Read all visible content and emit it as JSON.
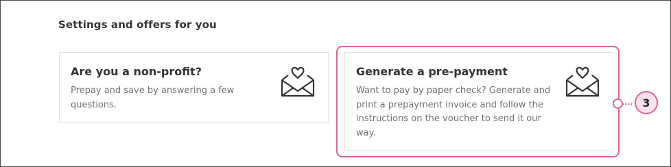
{
  "section": {
    "title": "Settings and offers for you"
  },
  "cards": [
    {
      "title": "Are you a non-profit?",
      "description": "Prepay and save by answering a few questions.",
      "icon": "envelope-heart-icon"
    },
    {
      "title": "Generate a pre-payment",
      "description": "Want to pay by paper check? Generate and print a prepayment invoice and follow the instructions on the voucher to send it our way.",
      "icon": "envelope-heart-icon"
    }
  ],
  "callout": {
    "number": "3",
    "color": "#e0609a",
    "fill": "#fde1ee"
  }
}
